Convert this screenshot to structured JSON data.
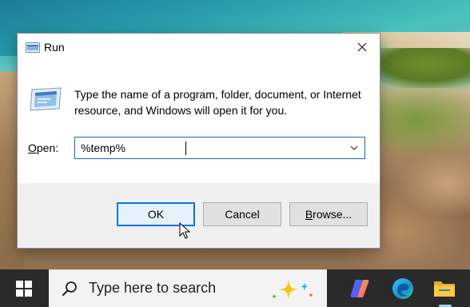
{
  "dialog": {
    "title": "Run",
    "description": "Type the name of a program, folder, document, or Internet resource, and Windows will open it for you.",
    "open_label_accel": "O",
    "open_label_rest": "pen:",
    "input_value": "%temp%",
    "buttons": {
      "ok": "OK",
      "cancel": "Cancel",
      "browse_accel": "B",
      "browse_rest": "rowse..."
    }
  },
  "taskbar": {
    "search_placeholder": "Type here to search",
    "pinned_apps": [
      "copilot-icon",
      "edge-icon",
      "file-explorer-icon"
    ]
  },
  "colors": {
    "accent": "#0078d7",
    "taskbar_bg": "#2a2a2a",
    "dialog_footer": "#f0f0f0"
  }
}
